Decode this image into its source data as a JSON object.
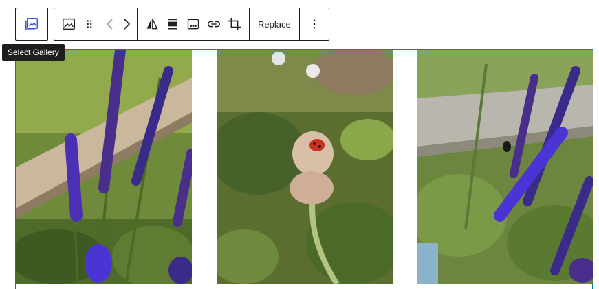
{
  "tooltip": {
    "text": "Select Gallery"
  },
  "toolbar": {
    "parent_icon": "gallery-icon",
    "buttons": [
      {
        "name": "image-icon"
      },
      {
        "name": "drag-handle-icon"
      },
      {
        "name": "move-arrows-icon"
      },
      {
        "name": "duotone-icon"
      },
      {
        "name": "align-icon"
      },
      {
        "name": "caption-icon"
      },
      {
        "name": "link-icon"
      },
      {
        "name": "crop-icon"
      }
    ],
    "replace_label": "Replace",
    "more_icon": "more-vertical-icon"
  },
  "gallery": {
    "images": [
      {
        "subject": "purple salvia flowers beside wooden raised bed"
      },
      {
        "subject": "ladybug on fluffy seed head"
      },
      {
        "subject": "purple salvia with bee in garden"
      }
    ]
  },
  "colors": {
    "accent": "#3858e9",
    "selection_border": "#007cba",
    "toolbar_text": "#1e1e1e",
    "tooltip_bg": "#1e1e1e"
  }
}
